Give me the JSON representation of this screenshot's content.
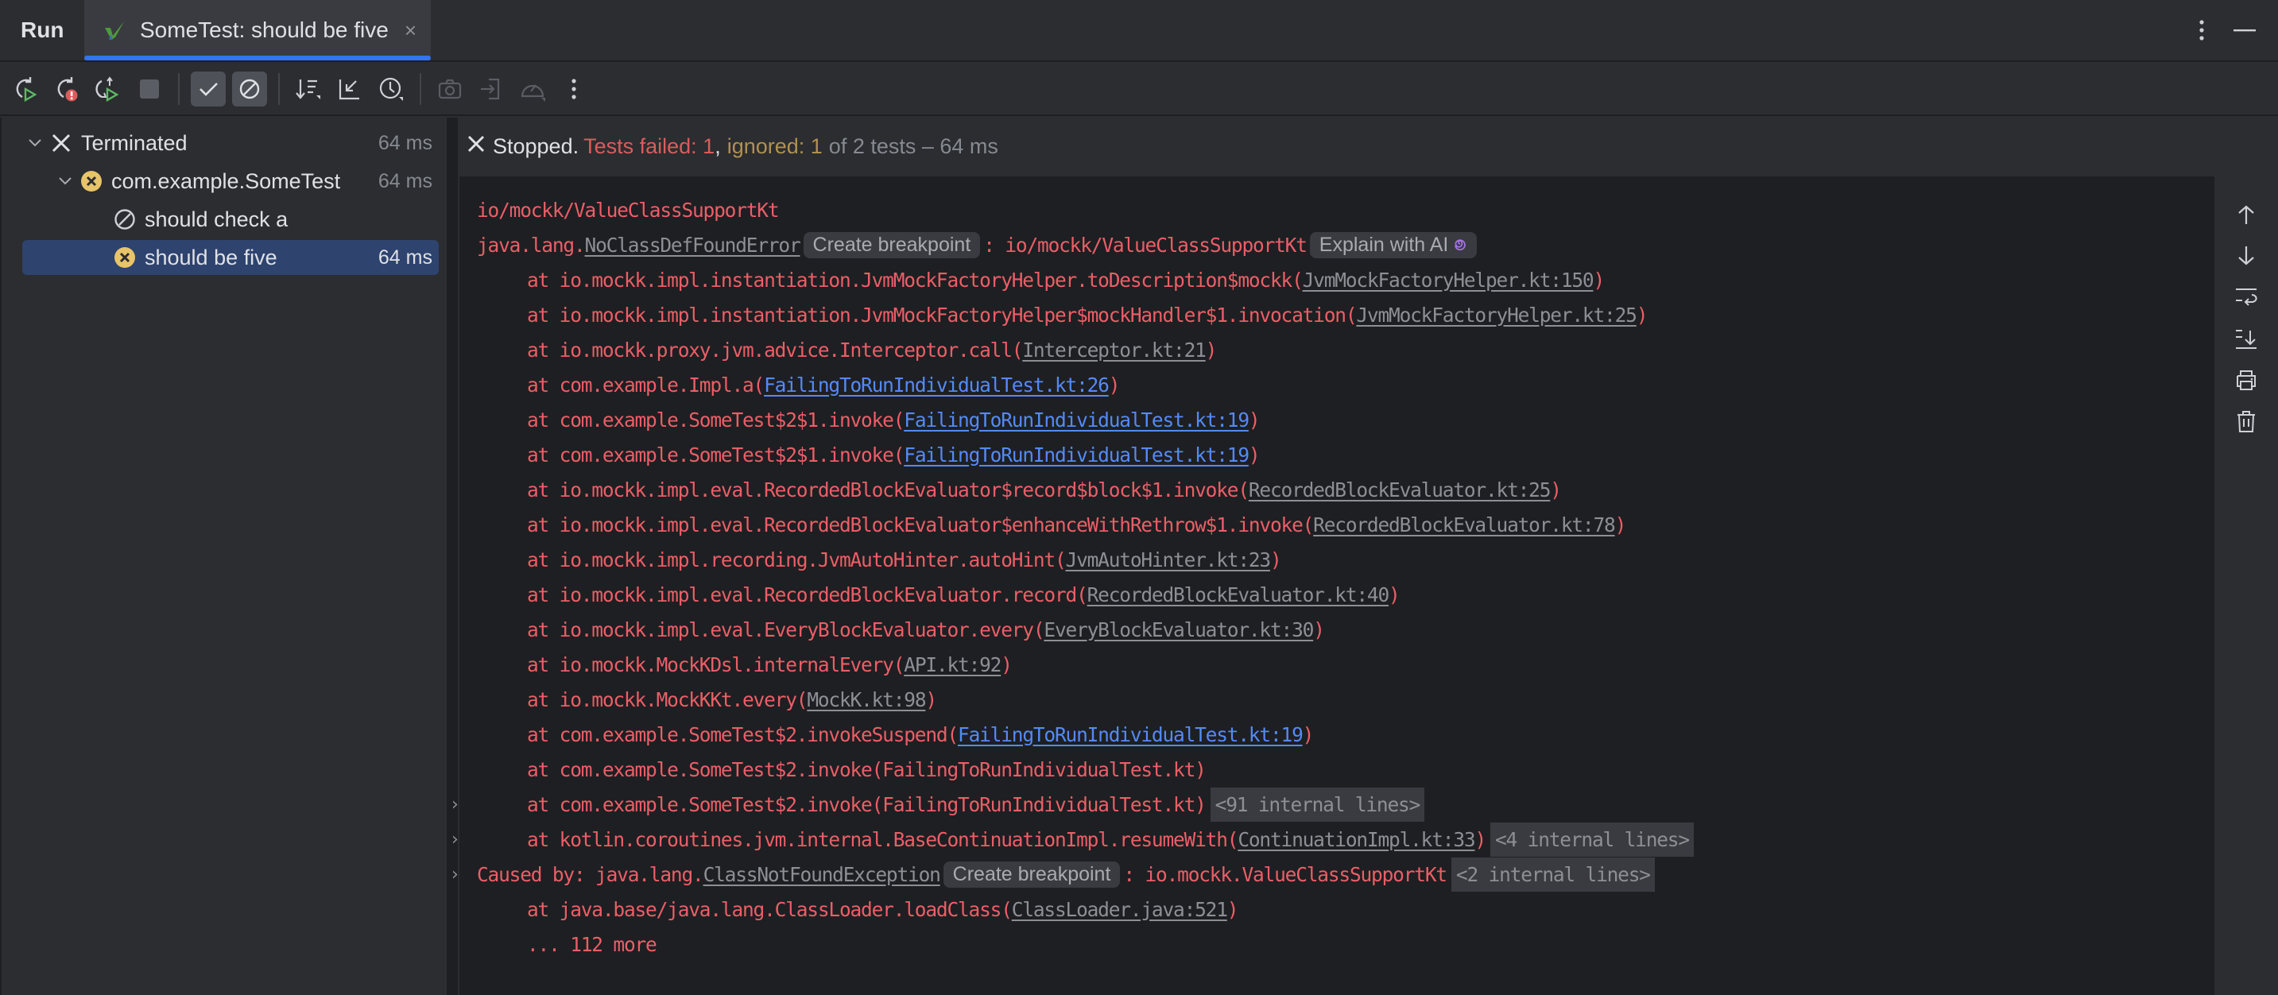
{
  "tabbar": {
    "run_label": "Run",
    "tab_title": "SomeTest: should be five",
    "tab_close": "×",
    "more_icon": "more-vertical-icon",
    "minimize_icon": "minimize-icon"
  },
  "toolbar": {
    "buttons": [
      {
        "name": "rerun",
        "icon": "rerun-icon"
      },
      {
        "name": "rerun-failed",
        "icon": "rerun-failed-icon"
      },
      {
        "name": "toggle-auto-test",
        "icon": "toggle-auto-test-icon"
      },
      {
        "name": "stop",
        "icon": "stop-icon",
        "disabled": true
      },
      {
        "name": "show-passed",
        "icon": "check-icon",
        "toggled": true
      },
      {
        "name": "show-ignored",
        "icon": "ignored-icon",
        "toggled": true
      },
      {
        "name": "sort",
        "icon": "sort-icon"
      },
      {
        "name": "collapse",
        "icon": "collapse-icon"
      },
      {
        "name": "test-history",
        "icon": "clock-icon"
      },
      {
        "name": "export",
        "icon": "camera-icon",
        "disabled": true
      },
      {
        "name": "import",
        "icon": "import-icon",
        "disabled": true
      },
      {
        "name": "coverage",
        "icon": "gauge-icon",
        "disabled": true
      },
      {
        "name": "more",
        "icon": "more-vertical-icon"
      }
    ]
  },
  "tree": [
    {
      "label": "Terminated",
      "time": "64 ms",
      "status": "terminated",
      "expanded": true
    },
    {
      "label": "com.example.SomeTest",
      "time": "64 ms",
      "status": "failed",
      "expanded": true
    },
    {
      "label": "should check a",
      "time": "",
      "status": "ignored"
    },
    {
      "label": "should be five",
      "time": "64 ms",
      "status": "failed",
      "selected": true
    }
  ],
  "status": {
    "stopped": "Stopped.",
    "failed": "Tests failed: 1",
    "comma": ",",
    "ignored": "ignored: 1",
    "rest": "of 2 tests – 64 ms"
  },
  "console": {
    "line0": "io/mockk/ValueClassSupportKt",
    "exc": {
      "prefix": "java.lang.",
      "name": "NoClassDefFoundError",
      "chip_breakpoint": "Create breakpoint",
      "suffix": ": io/mockk/ValueClassSupportKt",
      "chip_ai": "Explain with AI"
    },
    "frames": [
      {
        "pre": "at io.mockk.impl.instantiation.JvmMockFactoryHelper.toDescription$mockk(",
        "link": "JvmMockFactoryHelper.kt:150",
        "link_type": "grey",
        "post": ")"
      },
      {
        "pre": "at io.mockk.impl.instantiation.JvmMockFactoryHelper$mockHandler$1.invocation(",
        "link": "JvmMockFactoryHelper.kt:25",
        "link_type": "grey",
        "post": ")"
      },
      {
        "pre": "at io.mockk.proxy.jvm.advice.Interceptor.call(",
        "link": "Interceptor.kt:21",
        "link_type": "grey",
        "post": ")"
      },
      {
        "pre": "at com.example.Impl.a(",
        "link": "FailingToRunIndividualTest.kt:26",
        "link_type": "blue",
        "post": ")"
      },
      {
        "pre": "at com.example.SomeTest$2$1.invoke(",
        "link": "FailingToRunIndividualTest.kt:19",
        "link_type": "blue",
        "post": ")"
      },
      {
        "pre": "at com.example.SomeTest$2$1.invoke(",
        "link": "FailingToRunIndividualTest.kt:19",
        "link_type": "blue",
        "post": ")"
      },
      {
        "pre": "at io.mockk.impl.eval.RecordedBlockEvaluator$record$block$1.invoke(",
        "link": "RecordedBlockEvaluator.kt:25",
        "link_type": "grey",
        "post": ")"
      },
      {
        "pre": "at io.mockk.impl.eval.RecordedBlockEvaluator$enhanceWithRethrow$1.invoke(",
        "link": "RecordedBlockEvaluator.kt:78",
        "link_type": "grey",
        "post": ")"
      },
      {
        "pre": "at io.mockk.impl.recording.JvmAutoHinter.autoHint(",
        "link": "JvmAutoHinter.kt:23",
        "link_type": "grey",
        "post": ")"
      },
      {
        "pre": "at io.mockk.impl.eval.RecordedBlockEvaluator.record(",
        "link": "RecordedBlockEvaluator.kt:40",
        "link_type": "grey",
        "post": ")"
      },
      {
        "pre": "at io.mockk.impl.eval.EveryBlockEvaluator.every(",
        "link": "EveryBlockEvaluator.kt:30",
        "link_type": "grey",
        "post": ")"
      },
      {
        "pre": "at io.mockk.MockKDsl.internalEvery(",
        "link": "API.kt:92",
        "link_type": "grey",
        "post": ")"
      },
      {
        "pre": "at io.mockk.MockKKt.every(",
        "link": "MockK.kt:98",
        "link_type": "grey",
        "post": ")"
      },
      {
        "pre": "at com.example.SomeTest$2.invokeSuspend(",
        "link": "FailingToRunIndividualTest.kt:19",
        "link_type": "blue",
        "post": ")"
      },
      {
        "pre": "at com.example.SomeTest$2.invoke(FailingToRunIndividualTest.kt)",
        "link": "",
        "link_type": "none",
        "post": ""
      },
      {
        "pre": "at com.example.SomeTest$2.invoke(FailingToRunIndividualTest.kt)",
        "link": "",
        "link_type": "none",
        "post": "",
        "fold": "<91 internal lines>",
        "expandable": true
      },
      {
        "pre": "at kotlin.coroutines.jvm.internal.BaseContinuationImpl.resumeWith(",
        "link": "ContinuationImpl.kt:33",
        "link_type": "grey",
        "post": ")",
        "fold": "<4 internal lines>",
        "expandable": true
      }
    ],
    "caused": {
      "prefix": "Caused by: java.lang.",
      "name": "ClassNotFoundException",
      "chip_breakpoint": "Create breakpoint",
      "suffix": ": io.mockk.ValueClassSupportKt",
      "fold": "<2 internal lines>"
    },
    "caused_frame": {
      "pre": "at java.base/java.lang.ClassLoader.loadClass(",
      "link": "ClassLoader.java:521",
      "post": ")"
    },
    "more": "... 112 more"
  },
  "gutter": [
    "up-arrow-icon",
    "down-arrow-icon",
    "soft-wrap-icon",
    "scroll-to-end-icon",
    "print-icon",
    "trash-icon"
  ],
  "colors": {
    "accent": "#3574f0",
    "error_text": "#ec5e67",
    "link_blue": "#548af7",
    "ignored": "#b1914e",
    "selection": "#2e436e"
  }
}
